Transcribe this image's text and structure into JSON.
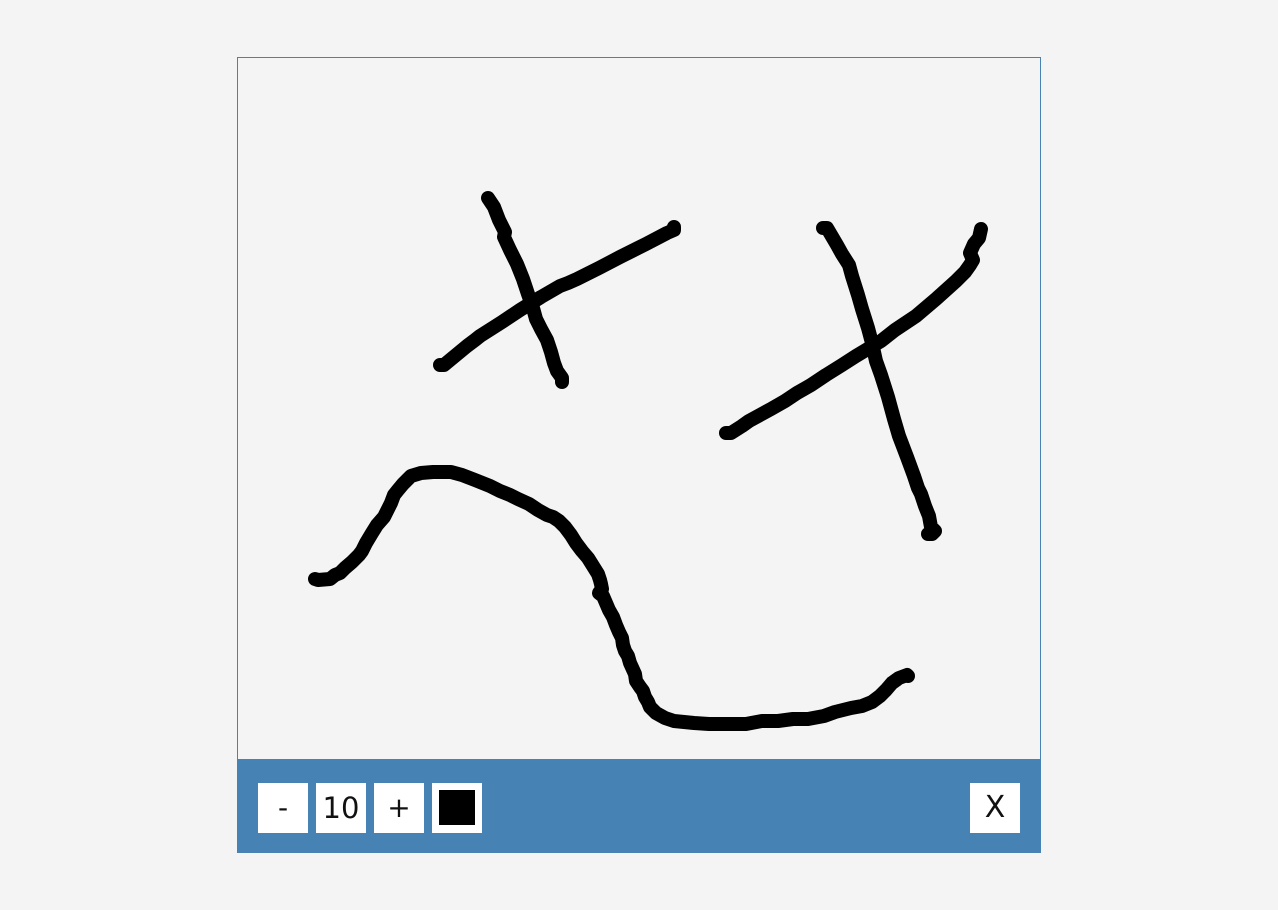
{
  "toolbar": {
    "decrease_label": "-",
    "brush_size": "10",
    "increase_label": "+",
    "close_label": "X",
    "brush_color": "#000000"
  },
  "theme": {
    "accent": "#4682b4",
    "background": "#f4f4f4",
    "stroke": "#000000"
  },
  "drawing": {
    "stroke_count": 5
  }
}
